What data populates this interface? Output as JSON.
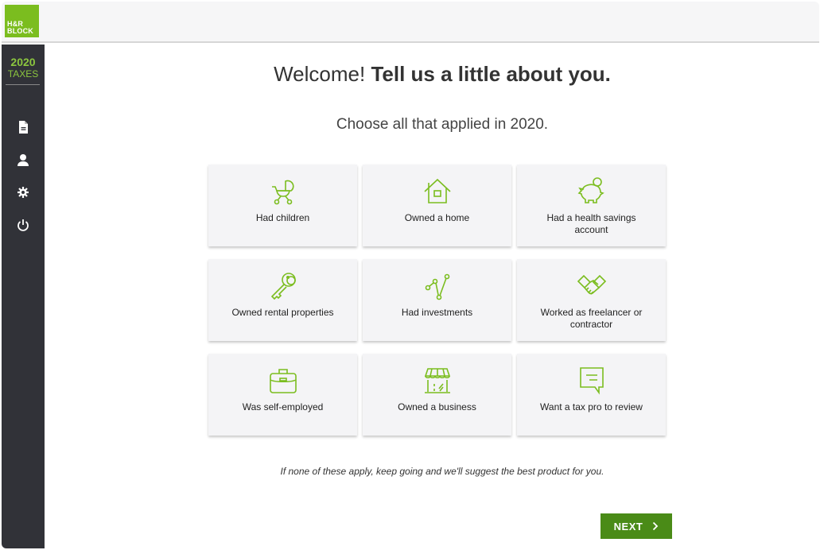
{
  "brand": {
    "logo_line1": "H&R",
    "logo_line2": "BLOCK",
    "accent": "#7bbd1f",
    "button_color": "#4a8b17"
  },
  "sidebar": {
    "year": "2020",
    "label": "TAXES",
    "items": [
      {
        "icon": "document-icon"
      },
      {
        "icon": "user-icon"
      },
      {
        "icon": "gear-icon"
      },
      {
        "icon": "power-icon"
      }
    ]
  },
  "header": {
    "welcome": "Welcome!",
    "title_bold": "Tell us a little about you.",
    "subtitle": "Choose all that applied in 2020."
  },
  "options": [
    {
      "label": "Had children",
      "icon": "baby-stroller-icon"
    },
    {
      "label": "Owned a home",
      "icon": "house-icon"
    },
    {
      "label": "Had a health savings account",
      "icon": "piggy-bank-icon"
    },
    {
      "label": "Owned rental properties",
      "icon": "key-icon"
    },
    {
      "label": "Had investments",
      "icon": "investment-chart-icon"
    },
    {
      "label": "Worked as freelancer or contractor",
      "icon": "handshake-icon"
    },
    {
      "label": "Was self-employed",
      "icon": "briefcase-icon"
    },
    {
      "label": "Owned a business",
      "icon": "storefront-icon"
    },
    {
      "label": "Want a tax pro to review",
      "icon": "chat-bubble-icon"
    }
  ],
  "footer_note": "If none of these apply, keep going and we'll suggest the best product for you.",
  "next_button": {
    "label": "NEXT",
    "icon": "chevron-right-icon"
  }
}
